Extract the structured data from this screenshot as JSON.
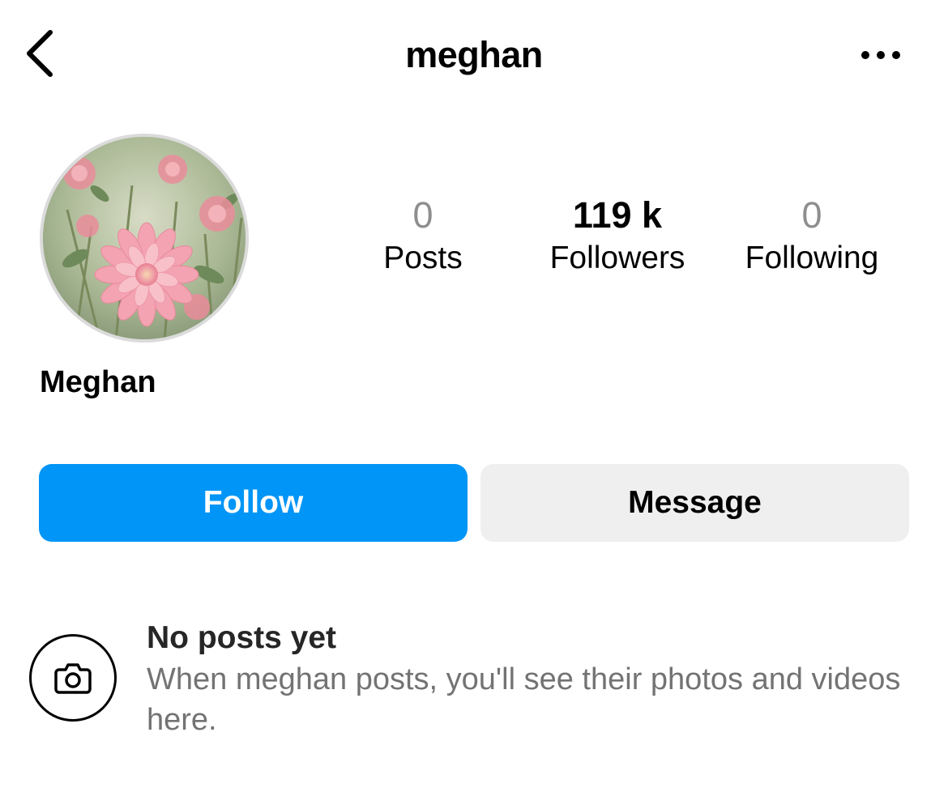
{
  "header": {
    "back_icon": "chevron-left-icon",
    "title": "meghan",
    "more_icon": "more-horizontal-icon"
  },
  "profile": {
    "avatar_alt": "pink-dahlia-flower",
    "display_name": "Meghan",
    "stats": [
      {
        "value": "0",
        "label": "Posts"
      },
      {
        "value": "119 k",
        "label": "Followers"
      },
      {
        "value": "0",
        "label": "Following"
      }
    ]
  },
  "actions": {
    "follow_label": "Follow",
    "message_label": "Message"
  },
  "empty_state": {
    "icon": "camera-icon",
    "title": "No posts yet",
    "text": "When meghan posts, you'll see their photos and videos here."
  },
  "colors": {
    "accent": "#0095f6",
    "secondary_button": "#efefef",
    "muted_text": "#737373",
    "stat_zero": "#8e8e8e"
  }
}
